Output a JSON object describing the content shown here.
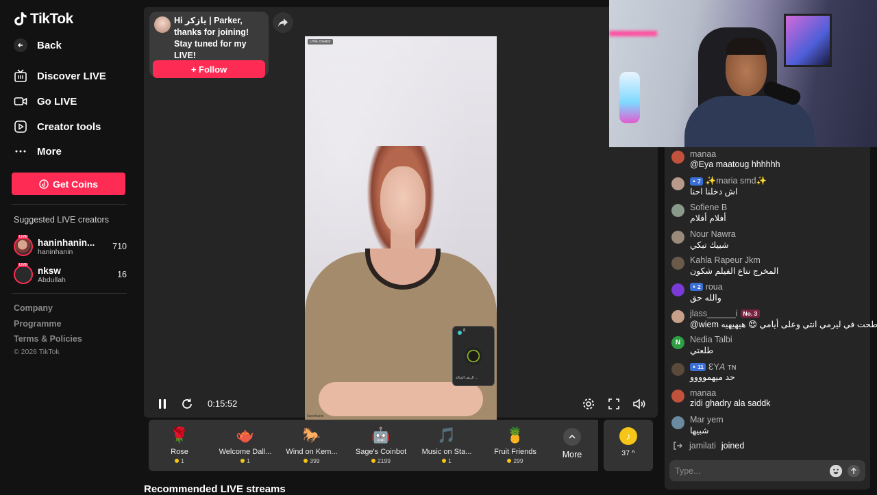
{
  "brand": {
    "name": "TikTok"
  },
  "sidebar": {
    "back_label": "Back",
    "nav": [
      {
        "label": "Discover LIVE",
        "icon": "tv-icon"
      },
      {
        "label": "Go LIVE",
        "icon": "video-camera-icon"
      },
      {
        "label": "Creator tools",
        "icon": "creator-tools-icon"
      },
      {
        "label": "More",
        "icon": "ellipsis-icon"
      }
    ],
    "get_coins_label": "Get Coins",
    "suggested_title": "Suggested LIVE creators",
    "live_badge": "LIVE",
    "creators": [
      {
        "display": "haninhanin...",
        "handle": "haninhanin",
        "count": "710"
      },
      {
        "display": "nksw",
        "handle": "Abdullah",
        "count": "16"
      }
    ],
    "footer": {
      "company": "Company",
      "programme": "Programme",
      "terms": "Terms & Policies",
      "copyright": "© 2026 TikTok"
    }
  },
  "player": {
    "welcome_text": "Hi يازكر | Parker, thanks for joining! Stay tuned for my LIVE!",
    "follow_label": "+ Follow",
    "video_tag": "LIVE creator",
    "video_watermark": "haninhanin",
    "elapsed": "0:15:52",
    "pip": {
      "count": "8",
      "label": "الريف المثالة ..."
    }
  },
  "gifts": [
    {
      "name": "Rose",
      "price": "1",
      "icon": "🌹"
    },
    {
      "name": "Welcome Dall...",
      "price": "1",
      "icon": "🫖"
    },
    {
      "name": "Wind on Kem...",
      "price": "399",
      "icon": "🐎"
    },
    {
      "name": "Sage's Coinbot",
      "price": "2199",
      "icon": "🤖"
    },
    {
      "name": "Music on Sta...",
      "price": "1",
      "icon": "🎵"
    },
    {
      "name": "Fruit Friends",
      "price": "299",
      "icon": "🍍"
    }
  ],
  "gift_more_label": "More",
  "coins_balance": "37 ^",
  "recommended_title": "Recommended LIVE streams",
  "chat": {
    "messages": [
      {
        "user": "manaa",
        "text": "@Eya maatoug hhhhhh",
        "level": "",
        "rank": "",
        "avatar_color": "#c2523c"
      },
      {
        "user": "✨maria smd✨",
        "text": "اش دخلنا احنا",
        "level": "7",
        "rank": "",
        "avatar_color": "#b89a8a"
      },
      {
        "user": "Sofiene B",
        "text": "أفلام أفلام",
        "level": "",
        "rank": "",
        "avatar_color": "#8a9a8a"
      },
      {
        "user": "Nour Nawra",
        "text": "شبيك تبكي",
        "level": "",
        "rank": "",
        "avatar_color": "#9a8a7a"
      },
      {
        "user": "Kahla Rapeur Jkm",
        "text": "المخرج نتاع الفيلم شكون",
        "level": "",
        "rank": "",
        "avatar_color": "#6a5a4a"
      },
      {
        "user": "roua",
        "text": "والله حق",
        "level": "2",
        "rank": "",
        "avatar_color": "#7a3ad6"
      },
      {
        "user": "jlass______i",
        "text": "@wiem طحت في ليرمي انتي وعلى أيامي 😍 هيهيهيه",
        "level": "",
        "rank": "No. 3",
        "avatar_color": "#c7a08a"
      },
      {
        "user": "Nedia Talbi",
        "text": "طلعتي",
        "level": "",
        "rank": "",
        "avatar_color": "#2ea043",
        "initial": "N"
      },
      {
        "user": "ƐY𝘈 ᴛɴ",
        "text": "حد ميهموووو",
        "level": "11",
        "rank": "",
        "avatar_color": "#5a4a3a"
      },
      {
        "user": "manaa",
        "text": "zidi ghadry ala saddk",
        "level": "",
        "rank": "",
        "avatar_color": "#c2523c"
      },
      {
        "user": "Mar yem",
        "text": "شبيها",
        "level": "",
        "rank": "",
        "avatar_color": "#6a8aa0"
      }
    ],
    "joined_user": "jamilati",
    "joined_text": "joined",
    "input_placeholder": "Type..."
  }
}
